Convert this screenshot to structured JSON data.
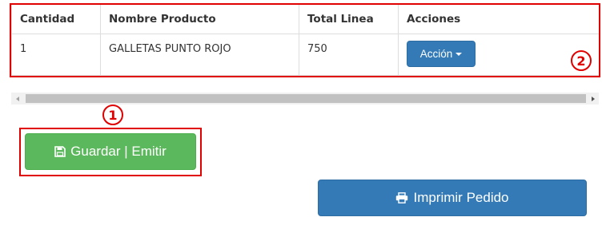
{
  "table": {
    "headers": [
      "Cantidad",
      "Nombre Producto",
      "Total Linea",
      "Acciones"
    ],
    "rows": [
      {
        "cantidad": "1",
        "nombre_producto": "GALLETAS PUNTO ROJO",
        "total_linea": "750"
      }
    ],
    "action_button_label": "Acción"
  },
  "buttons": {
    "save_emit_label": "Guardar | Emitir",
    "save_emit_icon": "floppy-disk-icon",
    "print_label": "Imprimir Pedido",
    "print_icon": "printer-icon"
  },
  "annotations": {
    "badge_1": "1",
    "badge_2": "2",
    "highlight_color": "#e00000"
  },
  "colors": {
    "success": "#5cb85c",
    "primary": "#337ab7"
  }
}
